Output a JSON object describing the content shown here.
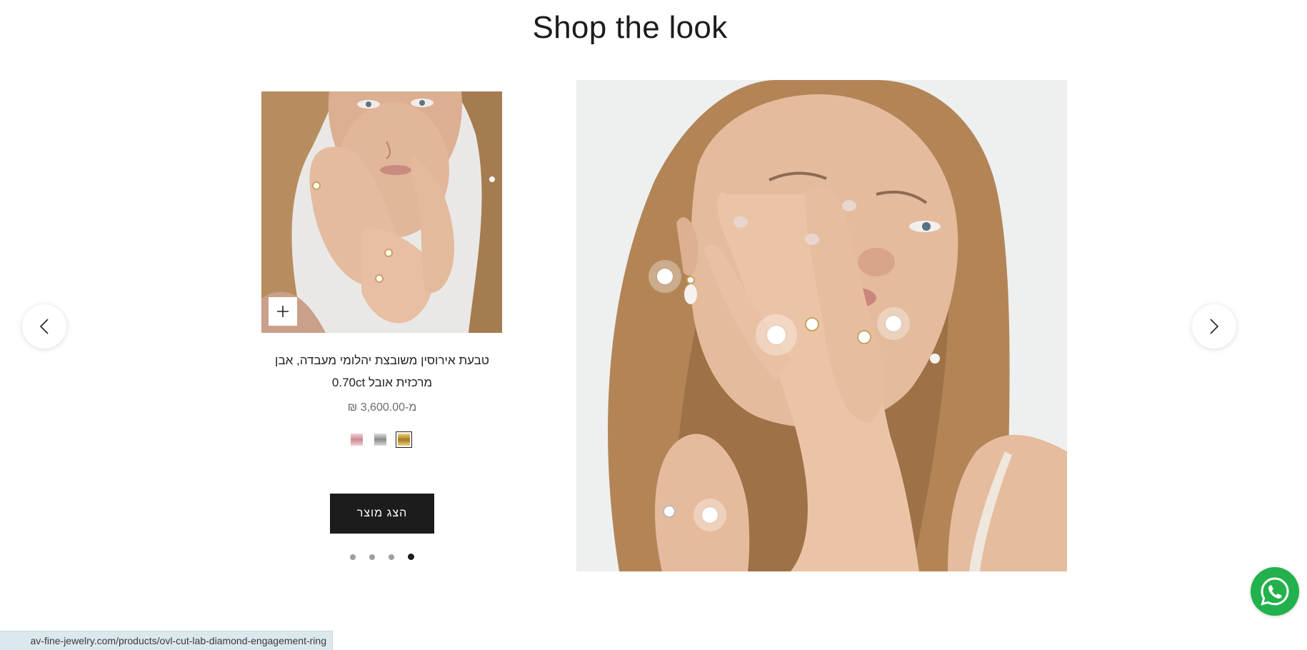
{
  "section": {
    "title": "Shop the look"
  },
  "carousel": {
    "prev_icon": "chevron-left-icon",
    "next_icon": "chevron-right-icon"
  },
  "product": {
    "title_line1": "טבעת אירוסין משובצת יהלומי מעבדה, אבן",
    "title_line2": "מרכזית אובל 0.70ct",
    "price": "מ-3,600.00 ₪",
    "quick_add_icon": "plus-icon",
    "swatches": [
      {
        "name": "rose-gold",
        "colors": [
          "#f4d0d4",
          "#c98a92"
        ],
        "selected": false
      },
      {
        "name": "silver",
        "colors": [
          "#dcdcdc",
          "#8a8a8a"
        ],
        "selected": false
      },
      {
        "name": "gold",
        "colors": [
          "#f2d27a",
          "#a5781f"
        ],
        "selected": true
      }
    ],
    "view_button": "הצג מוצר",
    "pagination": {
      "count": 4,
      "active": 4
    }
  },
  "look": {
    "hotspot_count": 4
  },
  "whatsapp": {
    "icon": "whatsapp-icon",
    "color": "#22b14c"
  },
  "status_bar": {
    "url": "av-fine-jewelry.com/products/ovl-cut-lab-diamond-engagement-ring"
  }
}
